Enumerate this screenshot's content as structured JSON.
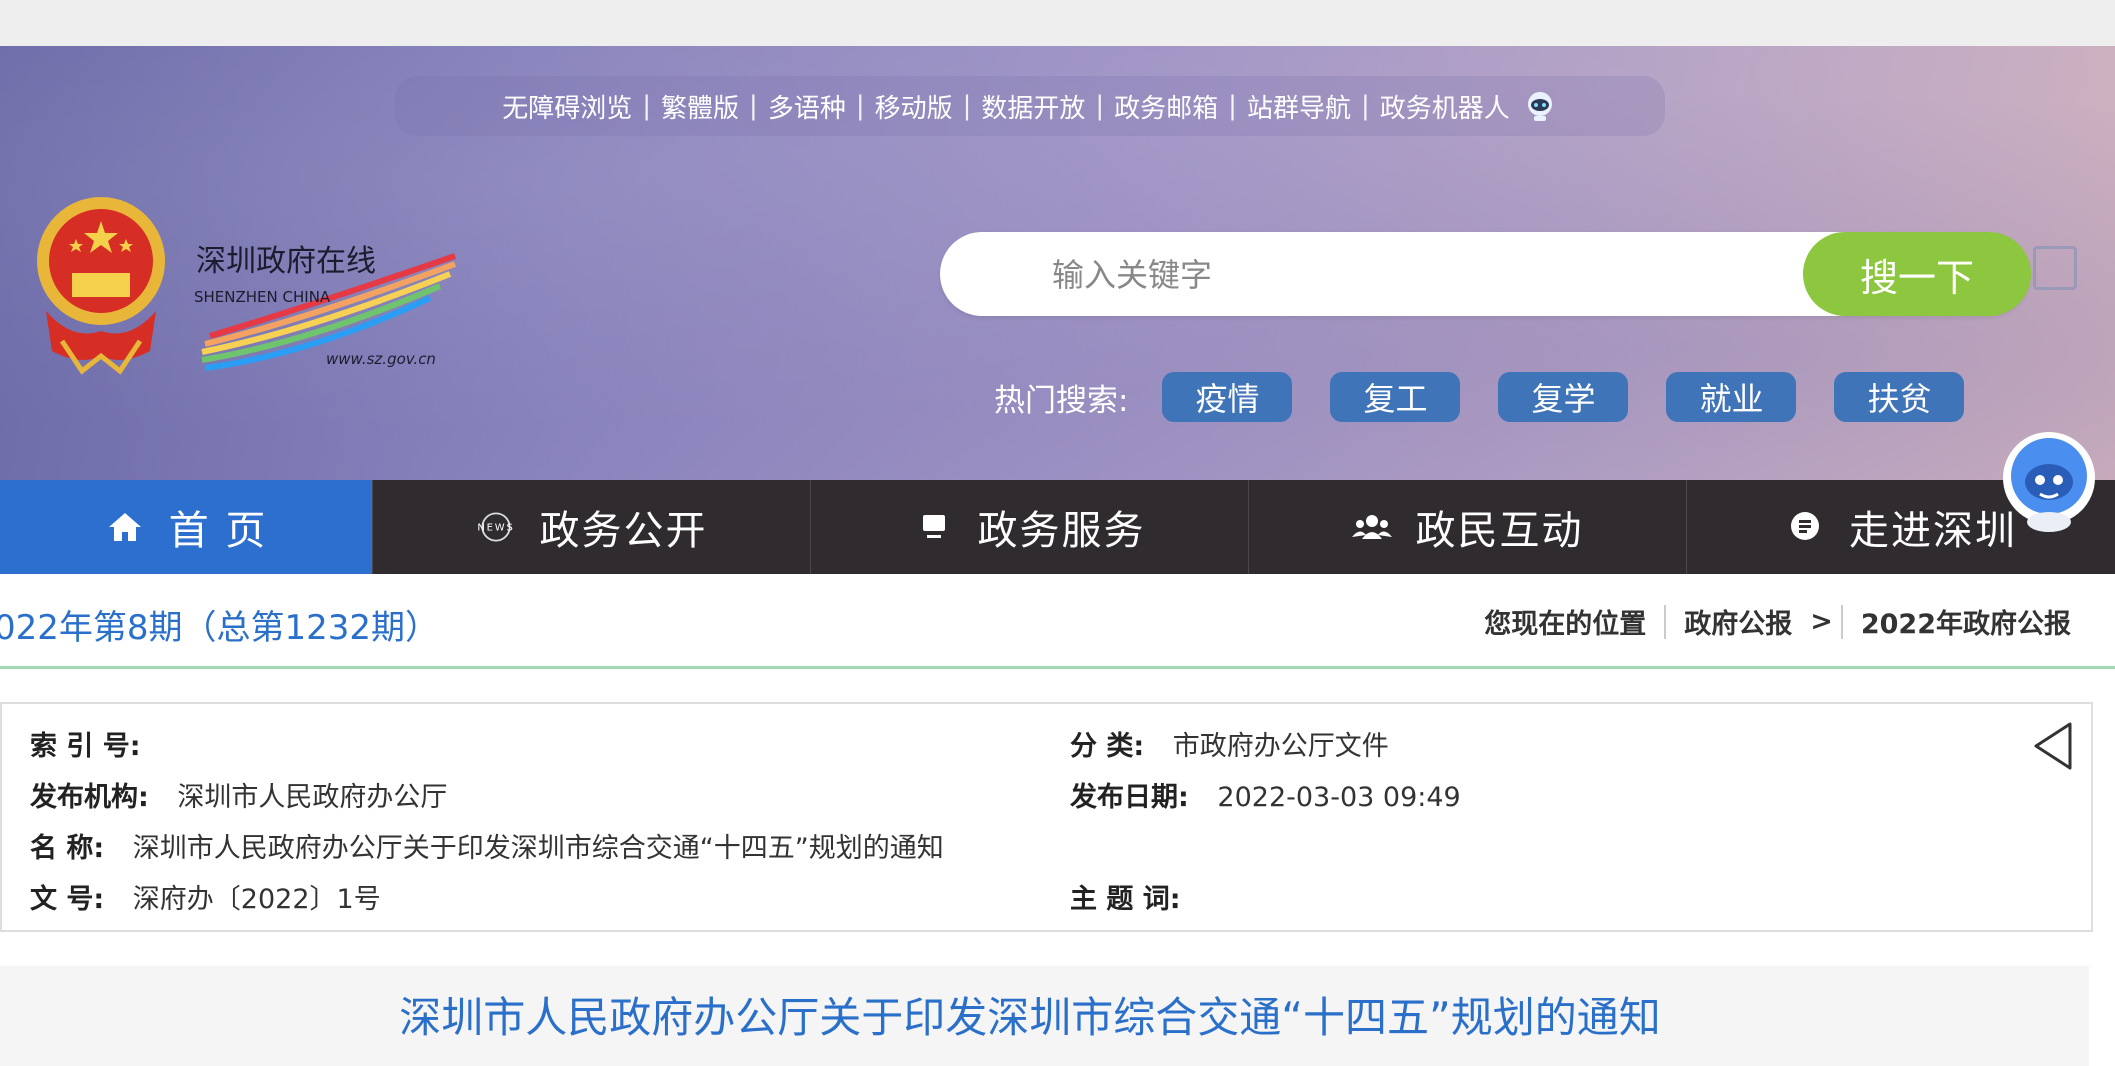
{
  "top_links": {
    "items": [
      "无障碍浏览",
      "繁體版",
      "多语种",
      "移动版",
      "数据开放",
      "政务邮箱",
      "站群导航",
      "政务机器人"
    ],
    "separator": "|"
  },
  "logo": {
    "text_cn": "深圳政府在线",
    "text_en": "SHENZHEN CHINA",
    "url": "www.sz.gov.cn"
  },
  "search": {
    "placeholder": "输入关键字",
    "button_label": "搜一下"
  },
  "hot_search": {
    "label": "热门搜索:",
    "tags": [
      "疫情",
      "复工",
      "复学",
      "就业",
      "扶贫"
    ]
  },
  "nav": {
    "items": [
      {
        "label": "首 页",
        "icon": "home-icon"
      },
      {
        "label": "政务公开",
        "icon": "news-icon"
      },
      {
        "label": "政务服务",
        "icon": "computer-icon"
      },
      {
        "label": "政民互动",
        "icon": "people-icon"
      },
      {
        "label": "走进深圳",
        "icon": "info-bubble-icon"
      }
    ]
  },
  "breadcrumb": {
    "issue": "022年第8期（总第1232期）",
    "location_label": "您现在的位置",
    "path": [
      "政府公报",
      "2022年政府公报"
    ],
    "gt": ">"
  },
  "info": {
    "index_label": "索 引 号:",
    "index_value": "",
    "category_label": "分 类:",
    "category_value": "市政府办公厅文件",
    "publisher_label": "发布机构:",
    "publisher_value": "深圳市人民政府办公厅",
    "date_label": "发布日期:",
    "date_value": "2022-03-03 09:49",
    "name_label": "名 称:",
    "name_value": "深圳市人民政府办公厅关于印发深圳市综合交通“十四五”规划的通知",
    "docno_label": "文 号:",
    "docno_value": "深府办〔2022〕1号",
    "subject_label": "主 题 词:",
    "subject_value": ""
  },
  "document": {
    "title": "深圳市人民政府办公厅关于印发深圳市综合交通“十四五”规划的通知"
  },
  "colors": {
    "nav_active": "#2d6fcf",
    "nav_bg": "#2f2b2e",
    "search_button": "#8dc63f",
    "hot_tag": "#3f74b9",
    "link_blue": "#2a6fc9"
  }
}
